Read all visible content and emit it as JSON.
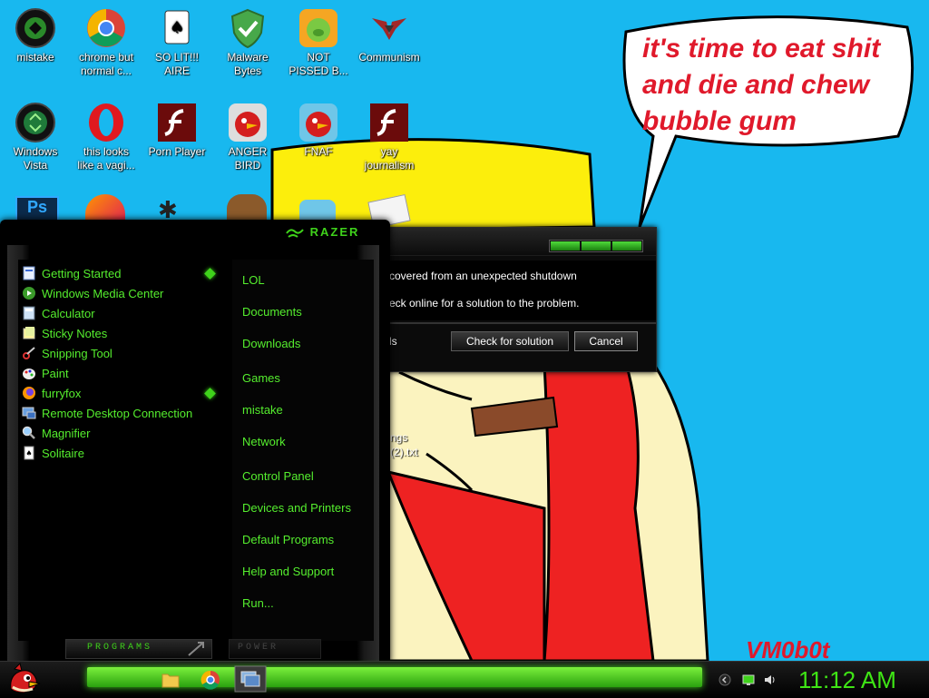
{
  "desktop": {
    "icons": [
      {
        "label": "mistake",
        "icon": "razer-orb-icon"
      },
      {
        "label": "chrome but\nnormal c...",
        "icon": "chrome-icon"
      },
      {
        "label": "SO LIT!!!\nAIRE",
        "icon": "solitaire-icon"
      },
      {
        "label": "Malware\nBytes",
        "icon": "shield-icon"
      },
      {
        "label": "NOT\nPISSED B...",
        "icon": "bad-piggies-icon"
      },
      {
        "label": "Communism",
        "icon": "emblem-icon"
      },
      {
        "label": "Windows\nVista",
        "icon": "recycle-bin-icon"
      },
      {
        "label": "this looks\nlike a vagi...",
        "icon": "opera-icon"
      },
      {
        "label": "Porn Player",
        "icon": "flash-icon"
      },
      {
        "label": "ANGER\nBIRD",
        "icon": "angry-bird-icon"
      },
      {
        "label": "FNAF",
        "icon": "angry-bird-icon"
      },
      {
        "label": "yay\njournalism",
        "icon": "flash-icon"
      }
    ],
    "speech_bubble": "it's time to eat shit and die and chew bubble gum",
    "watermark": "VM0b0t",
    "partial_file_label_1": "ngs",
    "partial_file_label_2": "(2).txt"
  },
  "dialog": {
    "message_line1": "covered from an unexpected shutdown",
    "message_line2": "eck online for a solution to the problem.",
    "details_label": "ls",
    "check_button": "Check for solution",
    "cancel_button": "Cancel"
  },
  "start_menu": {
    "brand": "RAZER",
    "programs": [
      {
        "label": "Getting Started",
        "icon": "getting-started-icon",
        "has_submenu": true
      },
      {
        "label": "Windows Media Center",
        "icon": "media-center-icon",
        "has_submenu": false
      },
      {
        "label": "Calculator",
        "icon": "calculator-icon",
        "has_submenu": false
      },
      {
        "label": "Sticky Notes",
        "icon": "sticky-notes-icon",
        "has_submenu": false
      },
      {
        "label": "Snipping Tool",
        "icon": "snipping-tool-icon",
        "has_submenu": false
      },
      {
        "label": "Paint",
        "icon": "paint-icon",
        "has_submenu": false
      },
      {
        "label": "furryfox",
        "icon": "firefox-icon",
        "has_submenu": true
      },
      {
        "label": "Remote Desktop Connection",
        "icon": "remote-desktop-icon",
        "has_submenu": false
      },
      {
        "label": "Magnifier",
        "icon": "magnifier-icon",
        "has_submenu": false
      },
      {
        "label": "Solitaire",
        "icon": "solitaire-icon",
        "has_submenu": false
      }
    ],
    "places": [
      "LOL",
      "Documents",
      "Downloads",
      "Games",
      "mistake",
      "Network",
      "Control Panel",
      "Devices and Printers",
      "Default Programs",
      "Help and Support",
      "Run..."
    ],
    "all_programs_label": "PROGRAMS",
    "power_label": "POWER"
  },
  "taskbar": {
    "clock": "11:12 AM",
    "pinned": [
      "explorer-icon",
      "chrome-icon",
      "window-switcher-icon"
    ],
    "tray": [
      "chevron-icon",
      "network-icon",
      "volume-icon"
    ]
  },
  "colors": {
    "accent_green": "#3fd21b",
    "desktop_blue": "#18b8ef",
    "speech_red": "#e0192b"
  }
}
